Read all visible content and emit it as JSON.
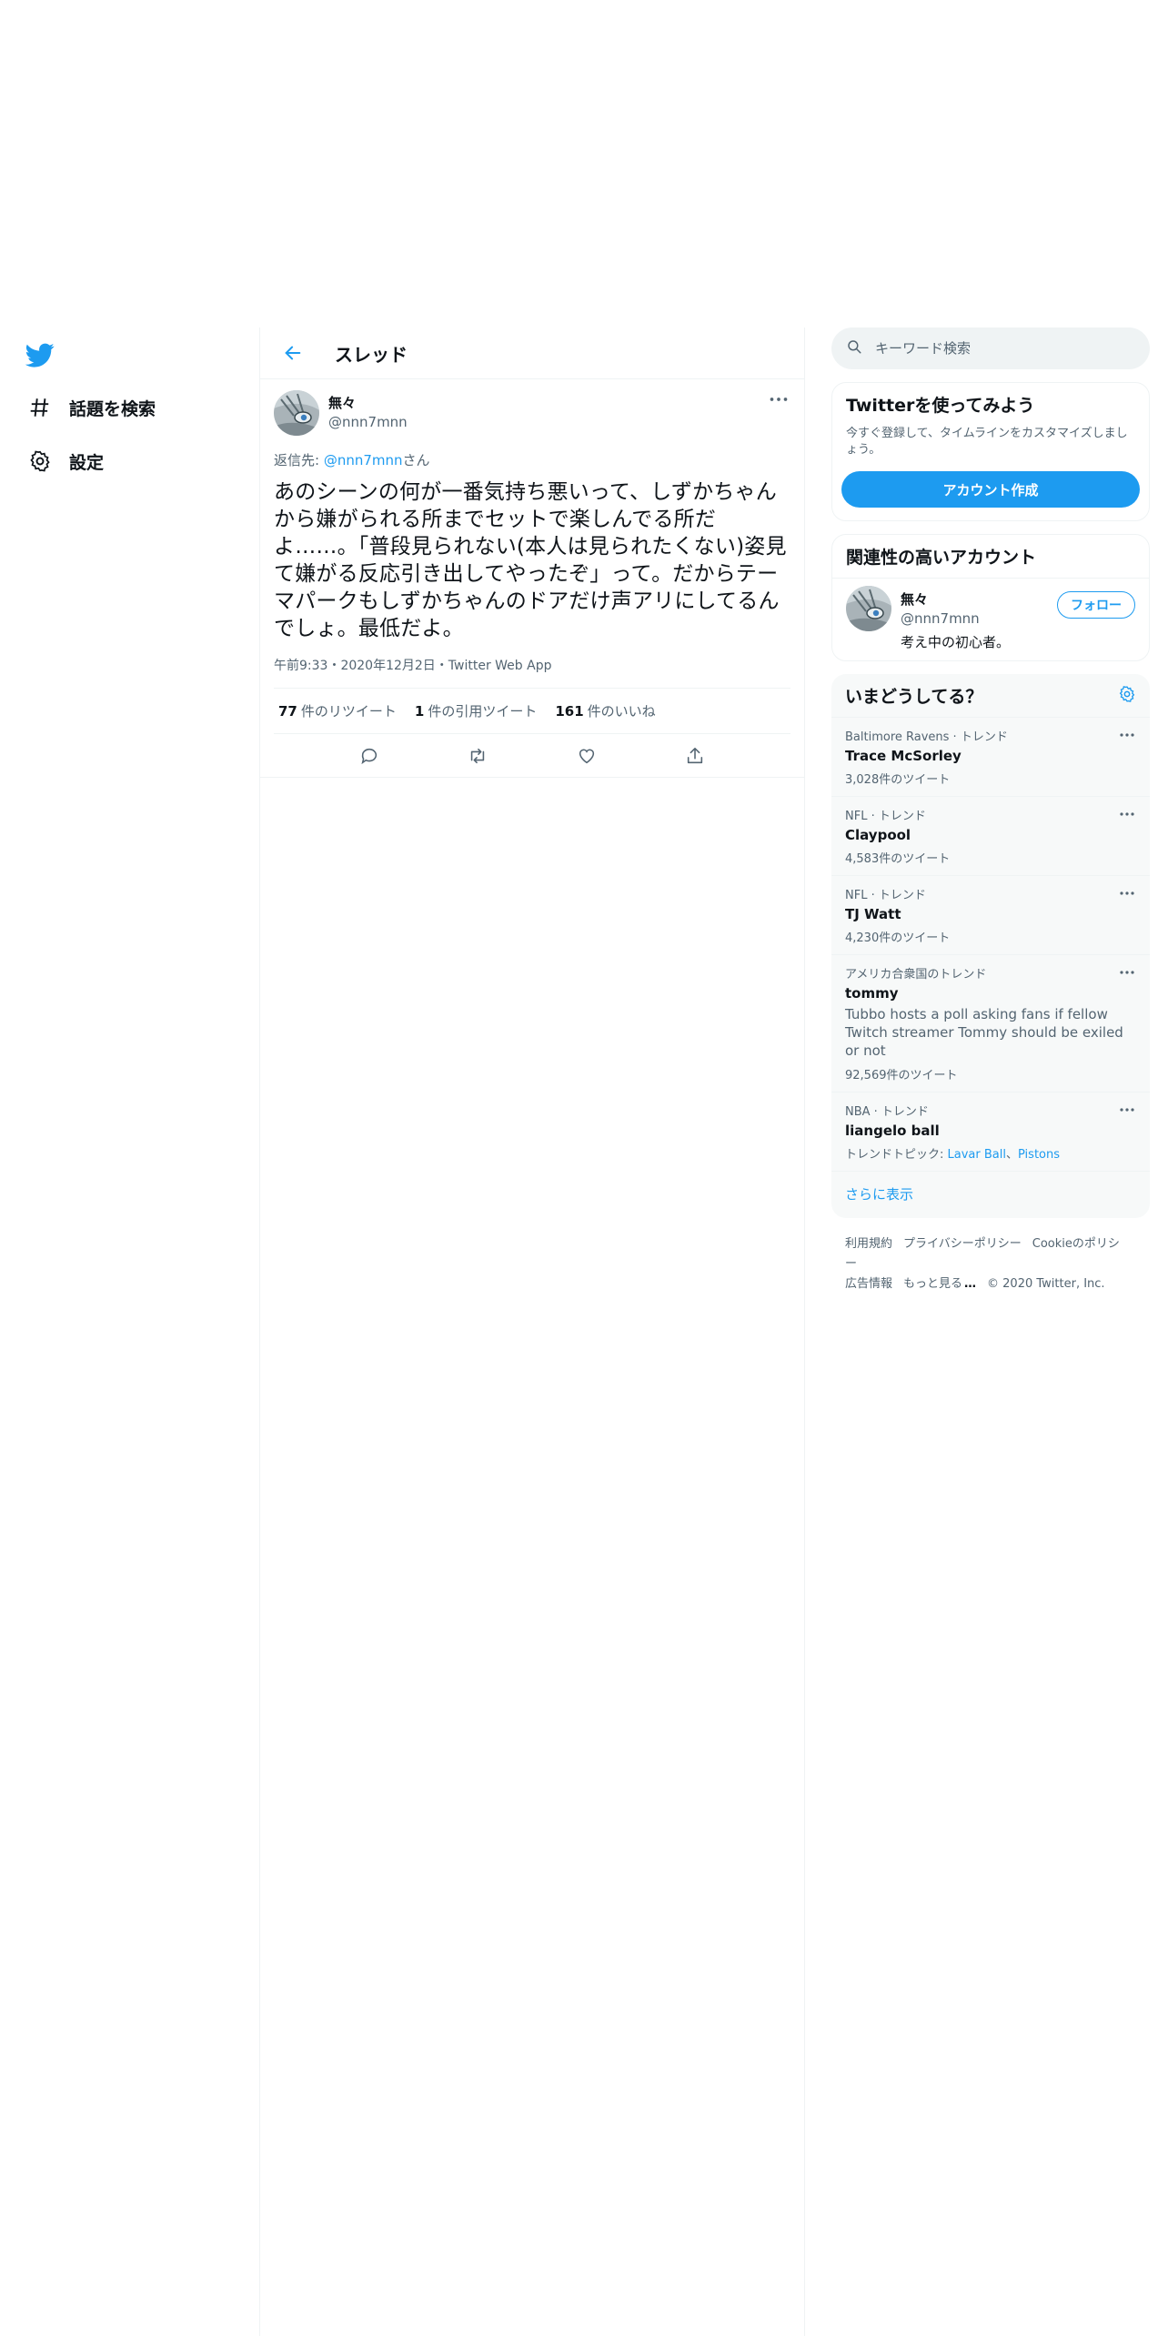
{
  "nav": {
    "logo": "twitter-bird-icon",
    "items": [
      {
        "icon": "hashtag-icon",
        "label": "話題を検索"
      },
      {
        "icon": "gear-icon",
        "label": "設定"
      }
    ]
  },
  "thread": {
    "title": "スレッド",
    "tweet": {
      "display_name": "無々",
      "handle": "@nnn7mnn",
      "reply_prefix": "返信先: ",
      "reply_mention": "@nnn7mnn",
      "reply_suffix": "さん",
      "text": "あのシーンの何が一番気持ち悪いって、しずかちゃんから嫌がられる所までセットで楽しんでる所だよ……。「普段見られない(本人は見られたくない)姿見て嫌がる反応引き出してやったぞ」って。だからテーマパークもしずかちゃんのドアだけ声アリにしてるんでしょ。最低だよ。",
      "meta": "午前9:33・2020年12月2日・Twitter Web App",
      "stats": {
        "retweets_count": "77",
        "retweets_label": "件のリツイート",
        "quotes_count": "1",
        "quotes_label": "件の引用ツイート",
        "likes_count": "161",
        "likes_label": "件のいいね"
      }
    }
  },
  "sidebar": {
    "search_placeholder": "キーワード検索",
    "signup": {
      "title": "Twitterを使ってみよう",
      "desc": "今すぐ登録して、タイムラインをカスタマイズしましょう。",
      "button": "アカウント作成"
    },
    "relevant": {
      "title": "関連性の高いアカウント",
      "account": {
        "name": "無々",
        "handle": "@nnn7mnn",
        "bio": "考え中の初心者。",
        "follow_label": "フォロー"
      }
    },
    "trends": {
      "title": "いまどうしてる？",
      "items": [
        {
          "context": "Baltimore Ravens · トレンド",
          "name": "Trace McSorley",
          "count": "3,028件のツイート"
        },
        {
          "context": "NFL · トレンド",
          "name": "Claypool",
          "count": "4,583件のツイート"
        },
        {
          "context": "NFL · トレンド",
          "name": "TJ Watt",
          "count": "4,230件のツイート"
        },
        {
          "context": "アメリカ合衆国のトレンド",
          "name": "tommy",
          "desc": "Tubbo hosts a poll asking fans if fellow Twitch streamer Tommy should be exiled or not",
          "count": "92,569件のツイート"
        },
        {
          "context": "NBA · トレンド",
          "name": "liangelo ball",
          "topics_label": "トレンドトピック: ",
          "topic1": "Lavar Ball",
          "topic_sep": "、",
          "topic2": "Pistons"
        }
      ],
      "show_more": "さらに表示"
    },
    "footer": {
      "terms": "利用規約",
      "privacy": "プライバシーポリシー",
      "cookies": "Cookieのポリシー",
      "ads": "広告情報",
      "more": "もっと見る",
      "copyright": "© 2020 Twitter, Inc."
    }
  },
  "colors": {
    "accent": "#1d9bf0",
    "text_primary": "#0f1419",
    "text_secondary": "#536471",
    "border": "#eff3f4",
    "trends_bg": "#f7f9f9"
  }
}
